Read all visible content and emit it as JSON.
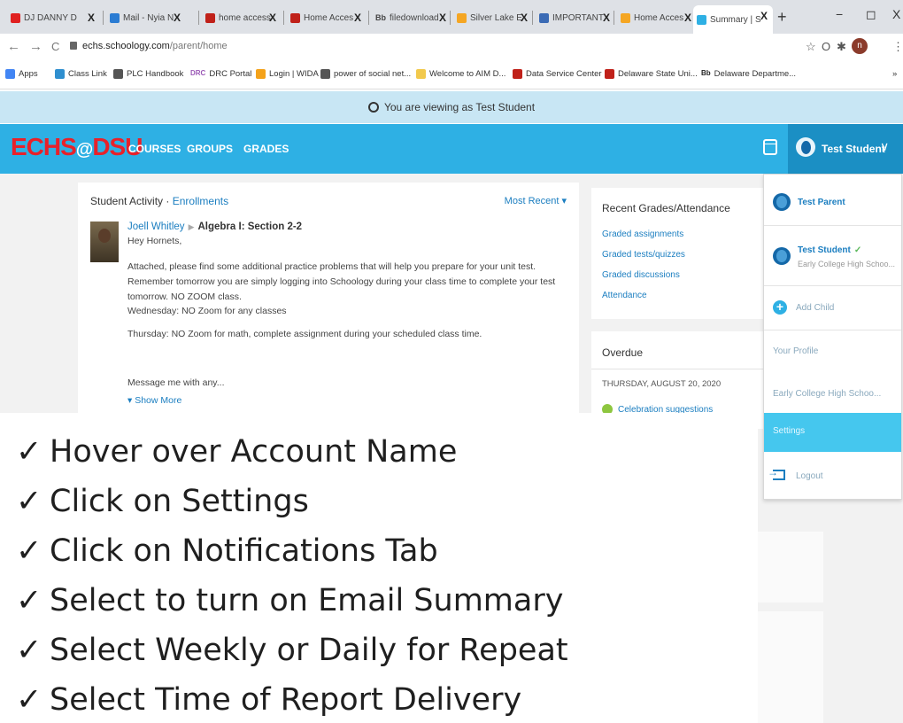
{
  "browser": {
    "tabs": [
      {
        "label": "DJ DANNY D",
        "icon_color": "#e02020"
      },
      {
        "label": "Mail - Nyia N",
        "icon_color": "#2b7cd3"
      },
      {
        "label": "home access",
        "icon_color": "#c0211a"
      },
      {
        "label": "Home Acces",
        "icon_color": "#c0211a"
      },
      {
        "label": "filedownload",
        "icon_text": "Bb"
      },
      {
        "label": "Silver Lake E",
        "icon_color": "#f5a623"
      },
      {
        "label": "IMPORTANT",
        "icon_color": "#3b6bb5"
      },
      {
        "label": "Home Acces",
        "icon_color": "#f5a623"
      },
      {
        "label": "Summary | S",
        "icon_color": "#2eb0e4",
        "active": true
      }
    ],
    "tab_close": "X",
    "new_tab": "+",
    "window_controls": {
      "minimize": "−",
      "restore": "◻",
      "close": "X"
    },
    "nav": {
      "back": "←",
      "forward": "→",
      "reload": "C"
    },
    "url": {
      "host": "echs.schoology.com",
      "path": "/parent/home"
    },
    "toolbar_icons": {
      "star": "☆",
      "extension": "O",
      "puzzle": "✱",
      "profile": "n",
      "menu": "⋮"
    },
    "bookmarks": [
      {
        "label": "Apps",
        "icon_color": "#4285f4"
      },
      {
        "label": "Class Link",
        "icon_color": "#2f8fcf"
      },
      {
        "label": "PLC Handbook",
        "icon_color": "#555555"
      },
      {
        "label": "DRC Portal",
        "icon_text": "DRC"
      },
      {
        "label": "Login | WIDA",
        "icon_color": "#f4a21a"
      },
      {
        "label": "power of social net...",
        "icon_color": "#555555"
      },
      {
        "label": "Welcome to AIM D...",
        "icon_color": "#f2c94c"
      },
      {
        "label": "Data Service Center",
        "icon_color": "#c0211a"
      },
      {
        "label": "Delaware State Uni...",
        "icon_color": "#c0211a"
      },
      {
        "label": "Delaware Departme...",
        "icon_text": "Bb"
      }
    ],
    "bookmarks_overflow": "»"
  },
  "banner": {
    "text": "You are viewing as Test Student"
  },
  "header": {
    "logo": {
      "part1": "ECHS",
      "at": "@",
      "part2": "DSU"
    },
    "nav": [
      "COURSES",
      "GROUPS",
      "GRADES"
    ],
    "account_name": "Test Student",
    "account_chevron": "∨",
    "colors": {
      "bar": "#2eb0e4",
      "account": "#1b8fc4",
      "logo": "#e8212a"
    }
  },
  "feed": {
    "title": "Student Activity · ",
    "title_link": "Enrollments",
    "sort": "Most Recent ▾",
    "post": {
      "author": "Joell Whitley",
      "arrow": "▶",
      "course": "Algebra I: Section 2-2",
      "lines": [
        "Hey Hornets,",
        "Attached, please find some additional practice problems that will help you prepare for your unit test. Remember tomorrow you are simply logging into Schoology during your class time to complete your test tomorrow. NO ZOOM class.",
        "Wednesday: NO Zoom for any classes",
        "Thursday: NO Zoom for math, complete assignment during your scheduled class time.",
        "Message me with any..."
      ],
      "show_more": "▾  Show More"
    }
  },
  "recent": {
    "title": "Recent Grades/Attendance",
    "links": [
      "Graded assignments",
      "Graded tests/quizzes",
      "Graded discussions",
      "Attendance"
    ]
  },
  "overdue": {
    "title": "Overdue",
    "date": "THURSDAY, AUGUST 20, 2020",
    "item": "Celebration suggestions"
  },
  "dropdown": {
    "parent": {
      "name": "Test Parent"
    },
    "student": {
      "name": "Test Student",
      "check": "✓",
      "school": "Early College High Schoo..."
    },
    "add_child": {
      "icon": "+",
      "label": "Add Child"
    },
    "your_profile": "Your Profile",
    "school": "Early College High Schoo...",
    "settings": "Settings",
    "logout": "Logout"
  },
  "instructions": {
    "check": "✓",
    "steps": [
      "Hover over Account Name",
      "Click on Settings",
      "Click on Notifications Tab",
      "Select to turn on Email Summary",
      "Select Weekly or Daily for Repeat",
      "Select Time of Report Delivery"
    ]
  }
}
